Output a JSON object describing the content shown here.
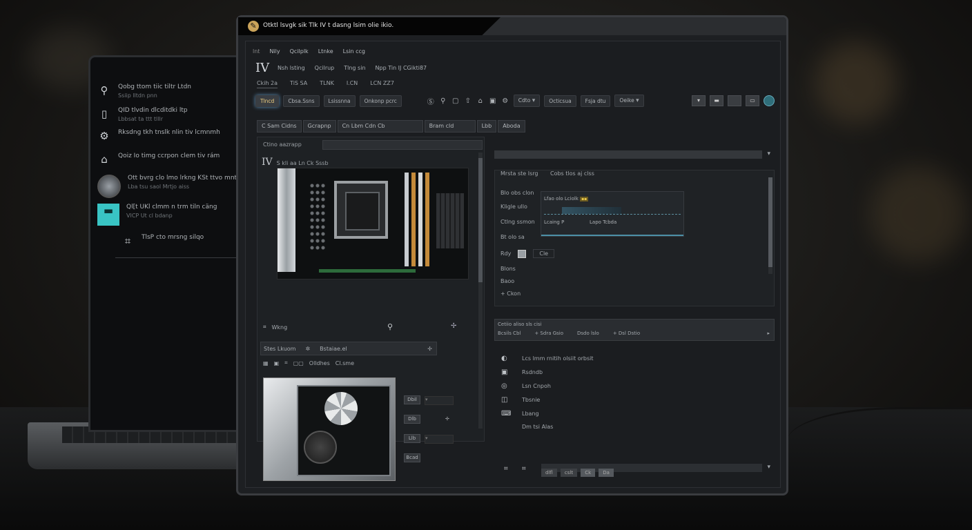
{
  "window": {
    "title": "Otktl lsvgk sik Tlk IV t dasng lsim olie ikio."
  },
  "menu": [
    "lnt",
    "Nily",
    "Qcilplk",
    "Ltnke",
    "Lsin ccg"
  ],
  "app": {
    "big_title": "IV",
    "sub_menu": [
      "Nsh lsting",
      "Qcilrup",
      "Tlng sin",
      "Npp Tin IJ CGikti87"
    ],
    "tabs": [
      "Ckih 2a",
      "TiS SA",
      "TLNK",
      "I.CN",
      "LCN ZZ7"
    ]
  },
  "toolbar": {
    "tabs": [
      "Tlncd",
      "Cbsa.Ssns",
      "Lsissnna",
      "Onkonp pcrc"
    ],
    "icons": [
      "Ⓢ",
      "⚲",
      "▢",
      "⇧",
      "⌂",
      "▣",
      "⚙"
    ],
    "dropdowns": [
      "Cdto",
      "Octicsua",
      "Fsja dtu",
      "Oeike"
    ],
    "right_buttons": [
      "▾",
      "▬",
      "",
      "▭"
    ]
  },
  "breadcrumb": [
    "C Sam Cidns",
    "Gcrapnp",
    "Cn Lbm Cdn Cb",
    "Bram cld",
    "Lbb",
    "Aboda"
  ],
  "left_panel": {
    "header": "Ctino aazrapp",
    "mobo_title_big": "IV",
    "mobo_title": "S kli aa Ln Ck Sssb",
    "row1_label": "Wkng",
    "bar_labels": [
      "Stes Lkuom",
      "Bstaiae.el"
    ],
    "row2": [
      "Olldhes",
      "Cl.sme"
    ],
    "fields": [
      "Dbil",
      "Dlb",
      "Llb",
      "Bcad"
    ]
  },
  "right_panel": {
    "section_title": "Mrsta ste Isrg",
    "section_sub": "Cobs tlos aj clss",
    "labels": [
      "Blo obs clon",
      "Kligle ullo",
      "Ctlng ssmon",
      "Bt olo sa"
    ],
    "chart_label1": "Lfao olo Lciolk",
    "chart_label2": "Lcaing P",
    "chart_label3": "Lapo Tcbda",
    "radio_label": "Rdy",
    "radio_value": "Cle",
    "list_small": [
      "Blons",
      "Baoo",
      "+ Ckon"
    ],
    "mid_title": "Cetiio aliso sls cisi",
    "mid_row": [
      "Bcsils Cbl",
      "+ Sdra Gsio",
      "Dsdo lslo",
      "+ Dsl Dstio"
    ],
    "list": [
      {
        "icon": "◐",
        "label": "Lcs lmm rnitih olsiit orbsit"
      },
      {
        "icon": "▣",
        "label": "Rsdndb"
      },
      {
        "icon": "◎",
        "label": "Lsn Cnpoh"
      },
      {
        "icon": "◫",
        "label": "Tbsnie"
      },
      {
        "icon": "⌨",
        "label": "Lbang"
      },
      {
        "icon": "",
        "label": "Dm tsi Alas"
      }
    ],
    "hscroll": [
      "dlfl",
      "cslt",
      "Ck",
      "Da"
    ]
  },
  "sidebar": {
    "items": [
      {
        "icon": "⚲",
        "label": "Qobg ttom tiic tiltr Ltdn",
        "sub": "Ssiip lltdn pnn"
      },
      {
        "icon": "▯",
        "label": "QID tlvdin dlcditdki ltp",
        "sub": "Lbbsat ta ttt tlllr"
      },
      {
        "icon": "⚙",
        "label": "Rksdng tkh tnslk nlin tiv lcmnmh",
        "sub": ""
      },
      {
        "icon": "⌂",
        "label": "Qoiz Io timg ccrpon clem tiv rám",
        "sub": ""
      },
      {
        "icon": "",
        "label": "Ott bvrg clo lmo lrkng KSt ttvo mntp",
        "sub": "Lba tsu saol Mrtjo aiss"
      },
      {
        "icon": "▬",
        "label": "Ql[t UKl clmm n trm tiln cäng",
        "sub": "VICP Ut cl bdanp"
      },
      {
        "icon": "⌗",
        "label": "TlsP cto mrsng silqo",
        "sub": ""
      }
    ]
  },
  "colors": {
    "accent": "#5c8fb8",
    "teal": "#39c4c4",
    "gold": "#e9c84a"
  }
}
